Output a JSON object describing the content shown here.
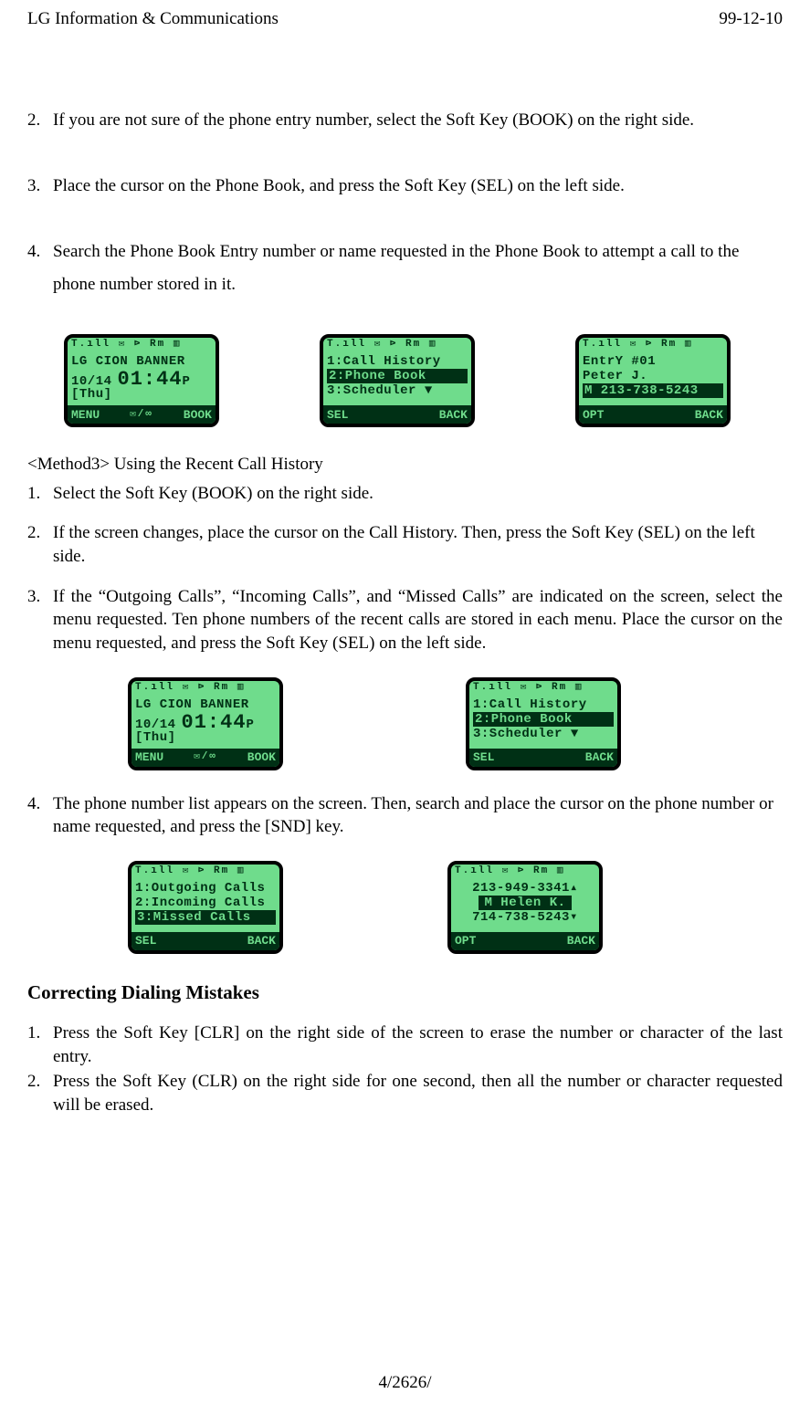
{
  "header": {
    "left": "LG Information & Communications",
    "right": "99-12-10"
  },
  "method2": {
    "items": [
      {
        "n": "2.",
        "text": "If you are not sure of the phone entry number, select the Soft Key (BOOK) on the right side."
      },
      {
        "n": "3.",
        "text": "Place the cursor on the Phone Book, and press the Soft Key (SEL) on the left side."
      },
      {
        "n": "4.",
        "text": "Search the Phone Book Entry number or name requested in the Phone Book to attempt a call to the phone number stored in it."
      }
    ]
  },
  "screensA": {
    "status": "T.ıll   ✉  ⊳  Rm  ▥",
    "s1": {
      "l1": "LG CION BANNER",
      "l2": "10/14",
      "time": "01:44",
      "ampm": "P",
      "day": "[Thu]",
      "soft_l": "MENU",
      "soft_c": "✉/∞",
      "soft_r": "BOOK"
    },
    "s2": {
      "l1": "1:Call History",
      "l2": "2:Phone Book",
      "l3": "3:Scheduler   ▼",
      "soft_l": "SEL",
      "soft_r": "BACK"
    },
    "s3": {
      "l1": "EntrY #01",
      "l2": "Peter J.",
      "l3": "M 213-738-5243",
      "soft_l": "OPT",
      "soft_r": "BACK"
    }
  },
  "method3": {
    "label": "<Method3> Using the Recent Call History",
    "items": [
      {
        "n": "1.",
        "text": "Select the Soft Key (BOOK) on the right side."
      },
      {
        "n": "2.",
        "text": "If the screen changes, place the cursor on the Call History. Then, press the Soft Key (SEL) on the left side."
      },
      {
        "n": "3.",
        "text": "If the “Outgoing Calls”, “Incoming Calls”, and “Missed Calls” are indicated on the screen, select the menu requested. Ten phone numbers of the recent calls are stored in each menu. Place the cursor on the menu requested, and press the Soft Key (SEL) on the left side."
      }
    ],
    "item4": {
      "n": "4.",
      "text": "The phone number list appears on the screen. Then, search and place the cursor on the phone number or name requested, and press the [SND] key."
    }
  },
  "screensC": {
    "s1": {
      "l1": "1:Outgoing Calls",
      "l2": "2:Incoming Calls",
      "l3": "3:Missed Calls",
      "soft_l": "SEL",
      "soft_r": "BACK"
    },
    "s2": {
      "l1": "213-949-3341▴",
      "l2": "M Helen K.",
      "l3": "714-738-5243▾",
      "soft_l": "OPT",
      "soft_r": "BACK"
    }
  },
  "correcting": {
    "heading": "Correcting Dialing Mistakes",
    "items": [
      {
        "n": "1.",
        "text": "Press the Soft Key [CLR] on the right side of the screen to erase the number or character of the last entry."
      },
      {
        "n": "2.",
        "text": "Press the Soft Key (CLR) on the right side for one second, then all the number or character requested will be erased."
      }
    ]
  },
  "footer": "4/2626/"
}
